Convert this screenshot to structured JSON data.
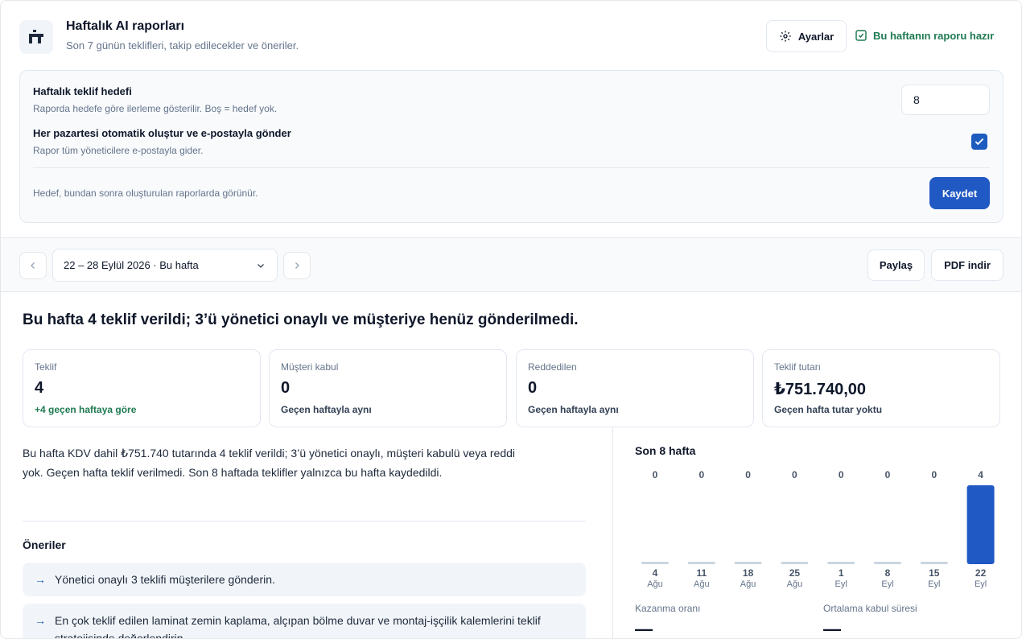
{
  "header": {
    "title": "Haftalık AI raporları",
    "subtitle": "Son 7 günün teklifleri, takip edilecekler ve öneriler.",
    "settings_label": "Ayarlar",
    "ready_label": "Bu haftanın raporu hazır",
    "logo_icon": "logo-icon"
  },
  "settings": {
    "goal_label": "Haftalık teklif hedefi",
    "goal_help": "Raporda hedefe göre ilerleme gösterilir. Boş = hedef yok.",
    "goal_value": "8",
    "auto_label": "Her pazartesi otomatik oluştur ve e-postayla gönder",
    "auto_help": "Rapor tüm yöneticilere e-postayla gider.",
    "auto_checked": true,
    "footer_note": "Hedef, bundan sonra oluşturulan raporlarda görünür.",
    "save_label": "Kaydet"
  },
  "toolbar": {
    "range_label": "22 – 28 Eylül 2026 · Bu hafta",
    "share_label": "Paylaş",
    "pdf_label": "PDF indir"
  },
  "report": {
    "headline": "Bu hafta 4 teklif verildi; 3’ü yönetici onaylı ve müşteriye henüz gönderilmedi.",
    "cards": [
      {
        "label": "Teklif",
        "value": "4",
        "delta": "+4 geçen haftaya göre"
      },
      {
        "label": "Müşteri kabul",
        "value": "0",
        "delta": "Geçen haftayla aynı"
      },
      {
        "label": "Reddedilen",
        "value": "0",
        "delta": "Geçen haftayla aynı"
      },
      {
        "label": "Teklif tutarı",
        "value": "₺751.740,00",
        "delta": "Geçen hafta tutar yoktu"
      }
    ],
    "summary": "Bu hafta KDV dahil ₺751.740 tutarında 4 teklif verildi; 3’ü yönetici onaylı, müşteri kabulü veya reddi yok. Geçen hafta teklif verilmedi. Son 8 haftada teklifler yalnızca bu hafta kaydedildi.",
    "recommendations_title": "Öneriler",
    "recommendations": [
      "Yönetici onaylı 3 teklifi müşterilere gönderin.",
      "En çok teklif edilen laminat zemin kaplama, alçıpan bölme duvar ve montaj-işçilik kalemlerini teklif stratejisinde değerlendirin."
    ]
  },
  "chart_data": {
    "type": "bar",
    "title": "Son 8 hafta",
    "categories": [
      [
        "4",
        "Ağu"
      ],
      [
        "11",
        "Ağu"
      ],
      [
        "18",
        "Ağu"
      ],
      [
        "25",
        "Ağu"
      ],
      [
        "1",
        "Eyl"
      ],
      [
        "8",
        "Eyl"
      ],
      [
        "15",
        "Eyl"
      ],
      [
        "22",
        "Eyl"
      ]
    ],
    "values": [
      0,
      0,
      0,
      0,
      0,
      0,
      0,
      4
    ],
    "ylim": [
      0,
      4
    ],
    "color_active": "#2159c4",
    "color_zero": "#cbd5e1"
  },
  "metrics": {
    "win_rate_label": "Kazanma oranı",
    "win_rate_value": "—",
    "avg_accept_label": "Ortalama kabul süresi",
    "avg_accept_value": "—"
  }
}
